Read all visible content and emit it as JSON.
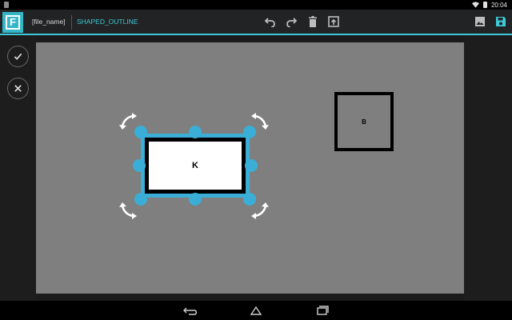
{
  "status_bar": {
    "time": "20:04",
    "icons": [
      "notification-icon",
      "wifi-icon",
      "battery-icon"
    ]
  },
  "action_bar": {
    "logo_letter": "F",
    "file_name": "[file_name]",
    "tool_name": "SHAPED_OUTLINE",
    "center_icons": [
      "undo-icon",
      "redo-icon",
      "delete-icon",
      "export-icon"
    ],
    "right_icons": [
      "image-icon",
      "save-icon"
    ]
  },
  "side_panel": {
    "buttons": [
      "confirm-icon",
      "cancel-icon"
    ]
  },
  "canvas": {
    "shapes": [
      {
        "label": "K",
        "selected": true
      },
      {
        "label": "B",
        "selected": false
      }
    ]
  },
  "nav_bar": {
    "buttons": [
      "back-icon",
      "home-icon",
      "recent-apps-icon"
    ]
  },
  "colors": {
    "accent": "#3dc9d8",
    "selection": "#3aaed6",
    "canvas_bg": "#7f7f7f",
    "logo_bg": "#35b6c8"
  }
}
